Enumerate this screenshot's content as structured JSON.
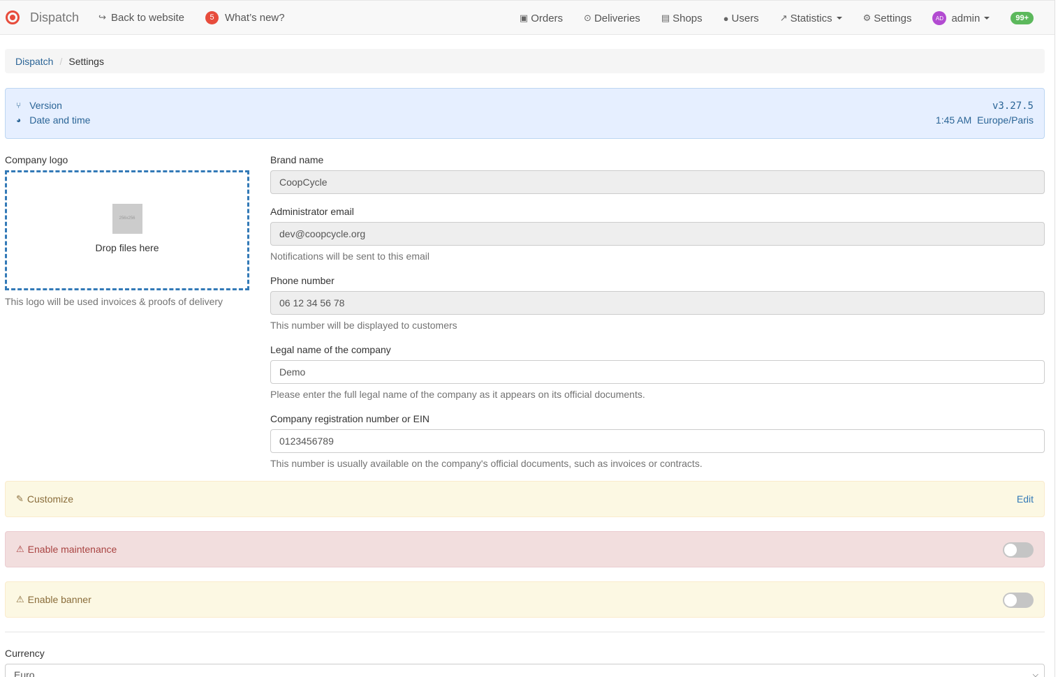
{
  "nav": {
    "brand": "Dispatch",
    "back_to_website": "Back to website",
    "whats_new_count": "5",
    "whats_new": "What’s new?",
    "orders": "Orders",
    "deliveries": "Deliveries",
    "shops": "Shops",
    "users": "Users",
    "statistics": "Statistics",
    "settings": "Settings",
    "avatar_initials": "AD",
    "user": "admin",
    "notifications": "99+"
  },
  "breadcrumb": {
    "root": "Dispatch",
    "current": "Settings"
  },
  "info": {
    "version_label": "Version",
    "version_value": "v3.27.5",
    "datetime_label": "Date and time",
    "time_value": "1:45 AM",
    "timezone_value": "Europe/Paris"
  },
  "logo": {
    "label": "Company logo",
    "thumb_text": "256x256",
    "drop_text": "Drop files here",
    "help": "This logo will be used invoices & proofs of delivery"
  },
  "form": {
    "brand_name_label": "Brand name",
    "brand_name_value": "CoopCycle",
    "admin_email_label": "Administrator email",
    "admin_email_value": "dev@coopcycle.org",
    "admin_email_help": "Notifications will be sent to this email",
    "phone_label": "Phone number",
    "phone_value": "06 12 34 56 78",
    "phone_help": "This number will be displayed to customers",
    "legal_name_label": "Legal name of the company",
    "legal_name_value": "Demo",
    "legal_name_help": "Please enter the full legal name of the company as it appears on its official documents.",
    "reg_label": "Company registration number or EIN",
    "reg_value": "0123456789",
    "reg_help": "This number is usually available on the company's official documents, such as invoices or contracts."
  },
  "panels": {
    "customize": "Customize",
    "customize_edit": "Edit",
    "maintenance": "Enable maintenance",
    "banner": "Enable banner"
  },
  "currency": {
    "label": "Currency",
    "value": "Euro"
  },
  "colors": {
    "accent": "#337ab7",
    "brand": "#e74c3c",
    "success": "#5cb85c",
    "warning_bg": "#fcf8e3",
    "danger_bg": "#f2dede"
  }
}
